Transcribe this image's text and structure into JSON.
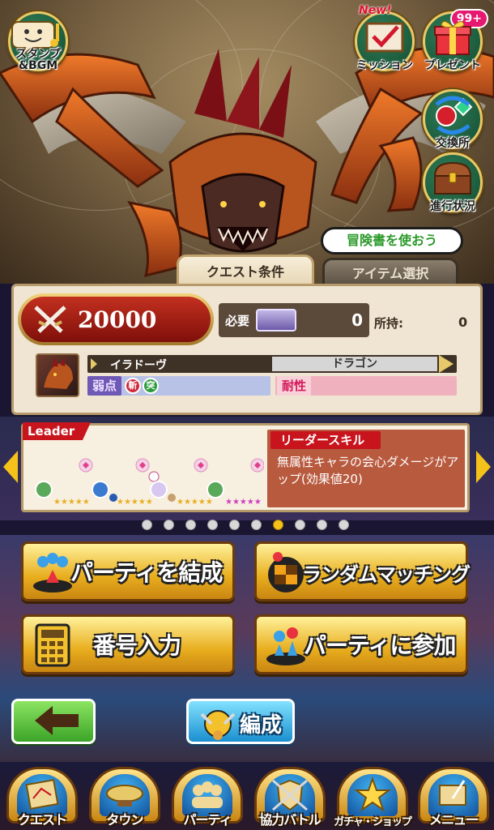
{
  "top_left": {
    "label_line1": "スタンプ",
    "label_line2": "&BGM",
    "icon": "stamp-speech-icon"
  },
  "top_right": {
    "mission": {
      "label": "ミッション",
      "new_tag": "New!",
      "icon": "mission-board-icon"
    },
    "present": {
      "label": "プレゼント",
      "badge": "99+",
      "icon": "gift-icon"
    },
    "exchange": {
      "label": "交換所",
      "icon": "exchange-icon"
    },
    "progress": {
      "label": "進行状況",
      "icon": "treasure-chest-icon"
    }
  },
  "adventure_book_bubble": "冒険書を使おう",
  "tabs": {
    "quest_conditions": "クエスト条件",
    "item_select": "アイテム選択"
  },
  "quest": {
    "reward_points": "20000",
    "need_label": "必要",
    "need_value": "0",
    "stock_label": "所持:",
    "stock_value": "0",
    "monster_name": "イラドーヴ",
    "monster_type": "ドラゴン",
    "weakness_label": "弱点",
    "weak_elements": [
      "斬",
      "突"
    ],
    "resist_label": "耐性"
  },
  "leader": {
    "tag": "Leader",
    "skill_title": "リーダースキル",
    "skill_text": "無属性キャラの会心ダメージがアップ(効果値20)"
  },
  "pager": {
    "total": 10,
    "active_index": 6
  },
  "buttons": {
    "form_party": "パーティを結成",
    "random_match": "ランダムマッチング",
    "number_input": "番号入力",
    "join_party": "パーティに参加",
    "edit": "編成"
  },
  "nav": [
    "クエスト",
    "タウン",
    "パーティ",
    "協力バトル",
    "ガチャ・ショップ",
    "メニュー"
  ],
  "colors": {
    "accent_gold": "#e8ad1e",
    "reward_red": "#c3301f",
    "leader_red": "#c8141d",
    "back_green": "#3ba427",
    "edit_blue": "#1b8fd0"
  }
}
